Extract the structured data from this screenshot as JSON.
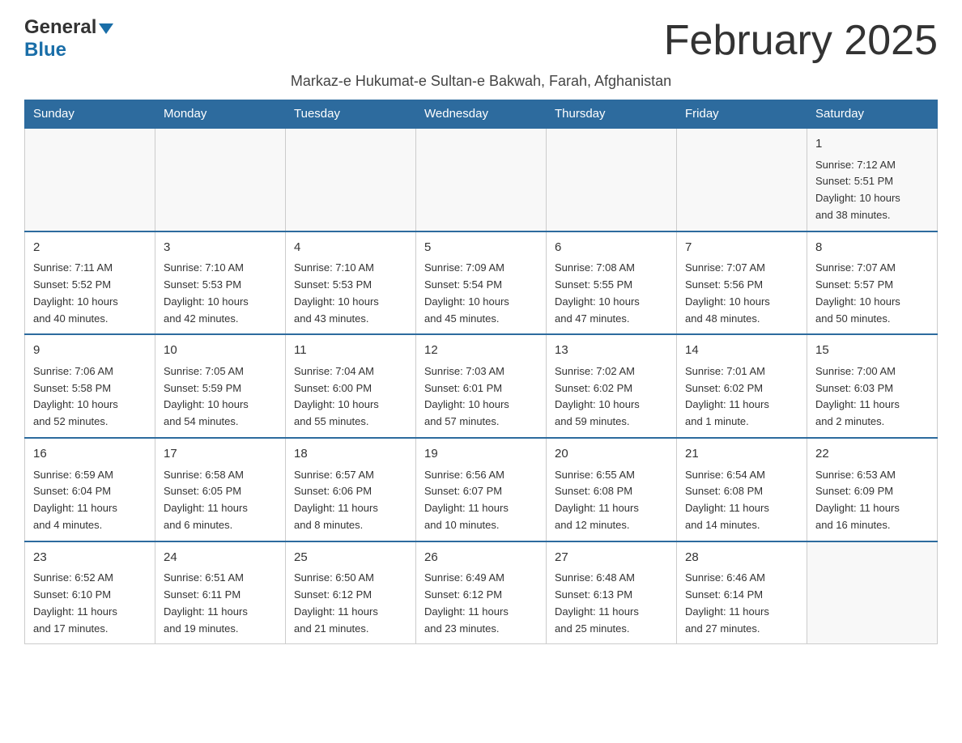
{
  "header": {
    "logo_general": "General",
    "logo_blue": "Blue",
    "month_title": "February 2025",
    "subtitle": "Markaz-e Hukumat-e Sultan-e Bakwah, Farah, Afghanistan"
  },
  "days_of_week": [
    "Sunday",
    "Monday",
    "Tuesday",
    "Wednesday",
    "Thursday",
    "Friday",
    "Saturday"
  ],
  "weeks": [
    {
      "days": [
        {
          "num": "",
          "info": ""
        },
        {
          "num": "",
          "info": ""
        },
        {
          "num": "",
          "info": ""
        },
        {
          "num": "",
          "info": ""
        },
        {
          "num": "",
          "info": ""
        },
        {
          "num": "",
          "info": ""
        },
        {
          "num": "1",
          "info": "Sunrise: 7:12 AM\nSunset: 5:51 PM\nDaylight: 10 hours\nand 38 minutes."
        }
      ]
    },
    {
      "days": [
        {
          "num": "2",
          "info": "Sunrise: 7:11 AM\nSunset: 5:52 PM\nDaylight: 10 hours\nand 40 minutes."
        },
        {
          "num": "3",
          "info": "Sunrise: 7:10 AM\nSunset: 5:53 PM\nDaylight: 10 hours\nand 42 minutes."
        },
        {
          "num": "4",
          "info": "Sunrise: 7:10 AM\nSunset: 5:53 PM\nDaylight: 10 hours\nand 43 minutes."
        },
        {
          "num": "5",
          "info": "Sunrise: 7:09 AM\nSunset: 5:54 PM\nDaylight: 10 hours\nand 45 minutes."
        },
        {
          "num": "6",
          "info": "Sunrise: 7:08 AM\nSunset: 5:55 PM\nDaylight: 10 hours\nand 47 minutes."
        },
        {
          "num": "7",
          "info": "Sunrise: 7:07 AM\nSunset: 5:56 PM\nDaylight: 10 hours\nand 48 minutes."
        },
        {
          "num": "8",
          "info": "Sunrise: 7:07 AM\nSunset: 5:57 PM\nDaylight: 10 hours\nand 50 minutes."
        }
      ]
    },
    {
      "days": [
        {
          "num": "9",
          "info": "Sunrise: 7:06 AM\nSunset: 5:58 PM\nDaylight: 10 hours\nand 52 minutes."
        },
        {
          "num": "10",
          "info": "Sunrise: 7:05 AM\nSunset: 5:59 PM\nDaylight: 10 hours\nand 54 minutes."
        },
        {
          "num": "11",
          "info": "Sunrise: 7:04 AM\nSunset: 6:00 PM\nDaylight: 10 hours\nand 55 minutes."
        },
        {
          "num": "12",
          "info": "Sunrise: 7:03 AM\nSunset: 6:01 PM\nDaylight: 10 hours\nand 57 minutes."
        },
        {
          "num": "13",
          "info": "Sunrise: 7:02 AM\nSunset: 6:02 PM\nDaylight: 10 hours\nand 59 minutes."
        },
        {
          "num": "14",
          "info": "Sunrise: 7:01 AM\nSunset: 6:02 PM\nDaylight: 11 hours\nand 1 minute."
        },
        {
          "num": "15",
          "info": "Sunrise: 7:00 AM\nSunset: 6:03 PM\nDaylight: 11 hours\nand 2 minutes."
        }
      ]
    },
    {
      "days": [
        {
          "num": "16",
          "info": "Sunrise: 6:59 AM\nSunset: 6:04 PM\nDaylight: 11 hours\nand 4 minutes."
        },
        {
          "num": "17",
          "info": "Sunrise: 6:58 AM\nSunset: 6:05 PM\nDaylight: 11 hours\nand 6 minutes."
        },
        {
          "num": "18",
          "info": "Sunrise: 6:57 AM\nSunset: 6:06 PM\nDaylight: 11 hours\nand 8 minutes."
        },
        {
          "num": "19",
          "info": "Sunrise: 6:56 AM\nSunset: 6:07 PM\nDaylight: 11 hours\nand 10 minutes."
        },
        {
          "num": "20",
          "info": "Sunrise: 6:55 AM\nSunset: 6:08 PM\nDaylight: 11 hours\nand 12 minutes."
        },
        {
          "num": "21",
          "info": "Sunrise: 6:54 AM\nSunset: 6:08 PM\nDaylight: 11 hours\nand 14 minutes."
        },
        {
          "num": "22",
          "info": "Sunrise: 6:53 AM\nSunset: 6:09 PM\nDaylight: 11 hours\nand 16 minutes."
        }
      ]
    },
    {
      "days": [
        {
          "num": "23",
          "info": "Sunrise: 6:52 AM\nSunset: 6:10 PM\nDaylight: 11 hours\nand 17 minutes."
        },
        {
          "num": "24",
          "info": "Sunrise: 6:51 AM\nSunset: 6:11 PM\nDaylight: 11 hours\nand 19 minutes."
        },
        {
          "num": "25",
          "info": "Sunrise: 6:50 AM\nSunset: 6:12 PM\nDaylight: 11 hours\nand 21 minutes."
        },
        {
          "num": "26",
          "info": "Sunrise: 6:49 AM\nSunset: 6:12 PM\nDaylight: 11 hours\nand 23 minutes."
        },
        {
          "num": "27",
          "info": "Sunrise: 6:48 AM\nSunset: 6:13 PM\nDaylight: 11 hours\nand 25 minutes."
        },
        {
          "num": "28",
          "info": "Sunrise: 6:46 AM\nSunset: 6:14 PM\nDaylight: 11 hours\nand 27 minutes."
        },
        {
          "num": "",
          "info": ""
        }
      ]
    }
  ]
}
